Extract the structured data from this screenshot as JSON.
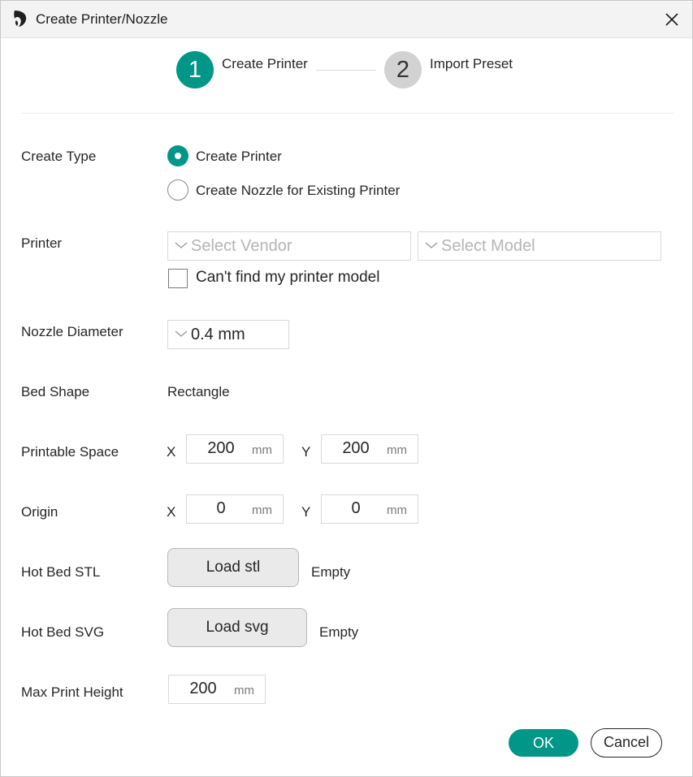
{
  "window": {
    "title": "Create Printer/Nozzle",
    "icons": {
      "app": "orca-slicer-logo-icon",
      "close": "close-icon"
    }
  },
  "steps": [
    {
      "number": "1",
      "label": "Create Printer",
      "active": true
    },
    {
      "number": "2",
      "label": "Import Preset",
      "active": false
    }
  ],
  "form": {
    "create_type": {
      "label": "Create Type",
      "options": [
        {
          "label": "Create Printer",
          "selected": true
        },
        {
          "label": "Create Nozzle for Existing Printer",
          "selected": false
        }
      ]
    },
    "printer": {
      "label": "Printer",
      "vendor_placeholder": "Select Vendor",
      "model_placeholder": "Select Model",
      "cant_find_label": "Can't find my printer model",
      "cant_find_checked": false
    },
    "nozzle_diameter": {
      "label": "Nozzle Diameter",
      "value": "0.4 mm"
    },
    "bed_shape": {
      "label": "Bed Shape",
      "value": "Rectangle"
    },
    "printable_space": {
      "label": "Printable Space",
      "x_label": "X",
      "x_value": "200",
      "y_label": "Y",
      "y_value": "200",
      "unit": "mm"
    },
    "origin": {
      "label": "Origin",
      "x_label": "X",
      "x_value": "0",
      "y_label": "Y",
      "y_value": "0",
      "unit": "mm"
    },
    "hot_bed_stl": {
      "label": "Hot Bed STL",
      "button": "Load stl",
      "status": "Empty"
    },
    "hot_bed_svg": {
      "label": "Hot Bed SVG",
      "button": "Load svg",
      "status": "Empty"
    },
    "max_print_height": {
      "label": "Max Print Height",
      "value": "200",
      "unit": "mm"
    }
  },
  "footer": {
    "ok": "OK",
    "cancel": "Cancel"
  },
  "colors": {
    "accent": "#009688",
    "inactive_step": "#d2d2d2",
    "button_bg": "#eaeaea"
  }
}
